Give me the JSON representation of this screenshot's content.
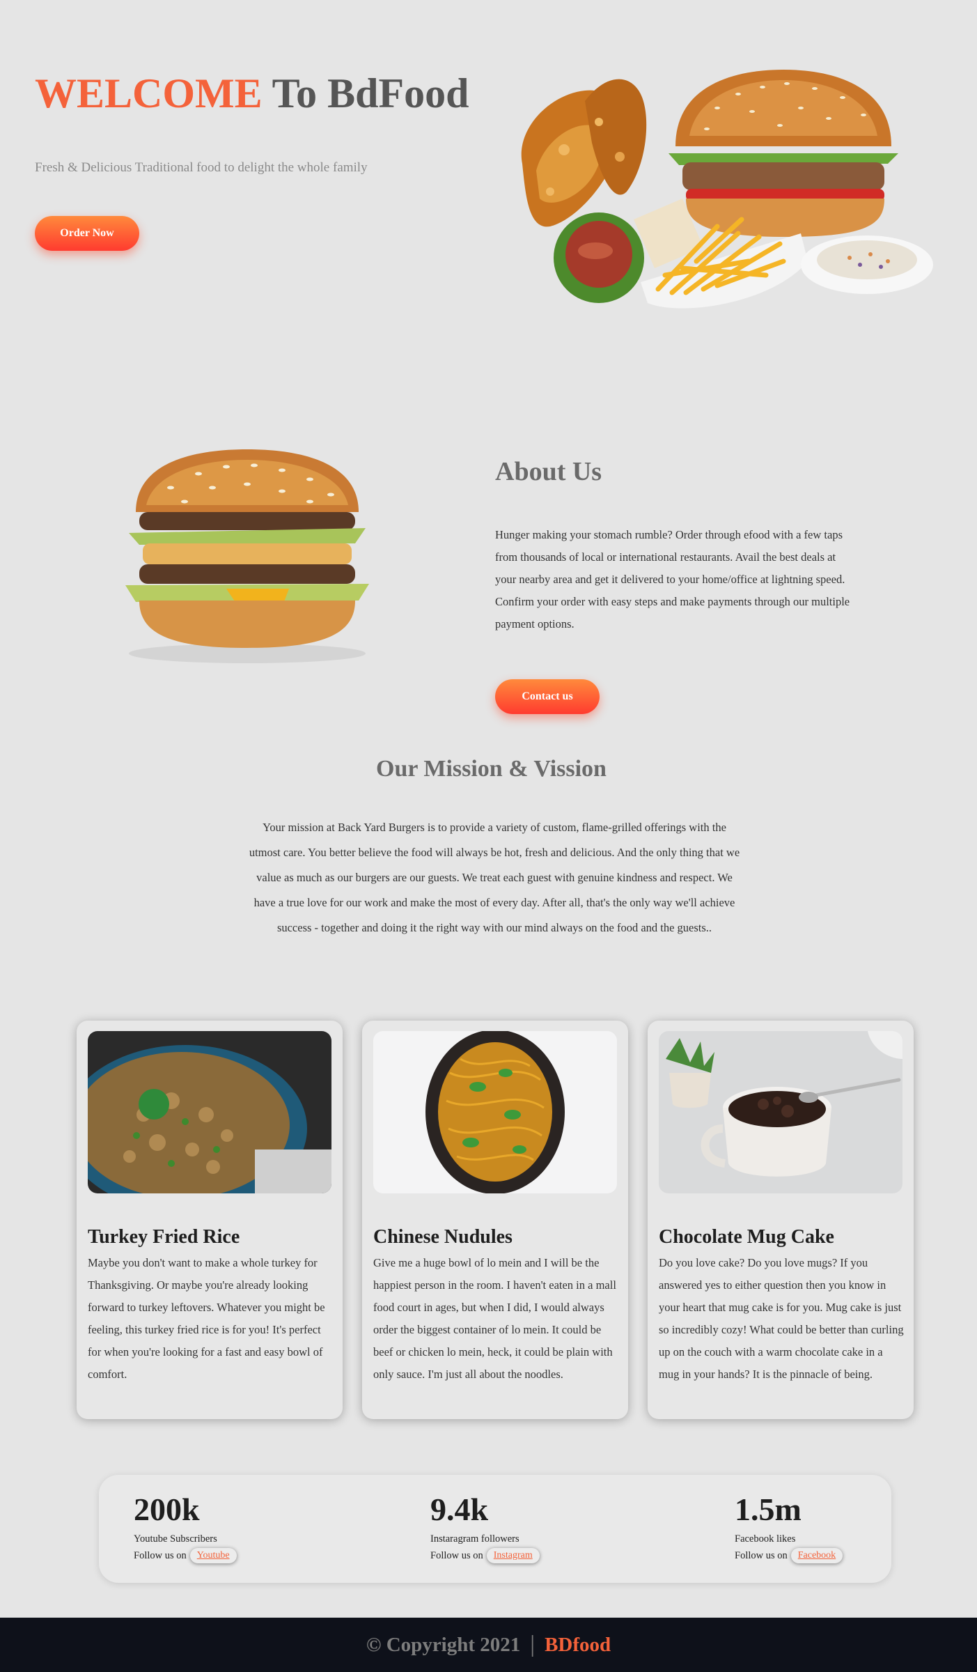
{
  "hero": {
    "title_accent": "WELCOME",
    "title_rest": " To BdFood",
    "subtitle": "Fresh & Delicious Traditional food to delight the whole family",
    "order_button": "Order Now"
  },
  "about": {
    "title": "About Us",
    "text": "Hunger making your stomach rumble? Order through efood with a few taps from thousands of local or international restaurants. Avail the best deals at your nearby area and get it delivered to your home/office at lightning speed. Confirm your order with easy steps and make payments through our multiple payment options.",
    "contact_button": "Contact us"
  },
  "mission": {
    "title": "Our Mission & Vission",
    "text": "Your mission at Back Yard Burgers is to provide a variety of custom, flame-grilled offerings with the utmost care. You better believe the food will always be hot, fresh and delicious. And the only thing that we value as much as our burgers are our guests. We treat each guest with genuine kindness and respect. We have a true love for our work and make the most of every day. After all, that's the only way we'll achieve success - together and doing it the right way with our mind always on the food and the guests.."
  },
  "cards": [
    {
      "title": "Turkey Fried Rice",
      "text": "Maybe you don't want to make a whole turkey for Thanksgiving. Or maybe you're already looking forward to turkey leftovers. Whatever you might be feeling, this turkey fried rice is for you! It's perfect for when you're looking for a fast and easy bowl of comfort."
    },
    {
      "title": "Chinese Nudules",
      "text": "Give me a huge bowl of lo mein and I will be the happiest person in the room. I haven't eaten in a mall food court in ages, but when I did, I would always order the biggest container of lo mein. It could be beef or chicken lo mein, heck, it could be plain with only sauce. I'm just all about the noodles."
    },
    {
      "title": "Chocolate Mug Cake",
      "text": "Do you love cake? Do you love mugs? If you answered yes to either question then you know in your heart that mug cake is for you. Mug cake is just so incredibly cozy! What could be better than curling up on the couch with a warm chocolate cake in a mug in your hands? It is the pinnacle of being."
    }
  ],
  "stats": [
    {
      "value": "200k",
      "label": "Youtube Subscribers",
      "follow": "Follow us on",
      "link": "Youtube"
    },
    {
      "value": "9.4k",
      "label": "Instaragram followers",
      "follow": "Follow us on",
      "link": "Instagram"
    },
    {
      "value": "1.5m",
      "label": "Facebook likes",
      "follow": "Follow us on",
      "link": "Facebook"
    }
  ],
  "footer": {
    "copyright": "© Copyright 2021",
    "separator": "|",
    "brand": "BDfood"
  },
  "colors": {
    "accent": "#f4623a",
    "background": "#e5e5e5",
    "footer_bg": "#0e111a"
  }
}
